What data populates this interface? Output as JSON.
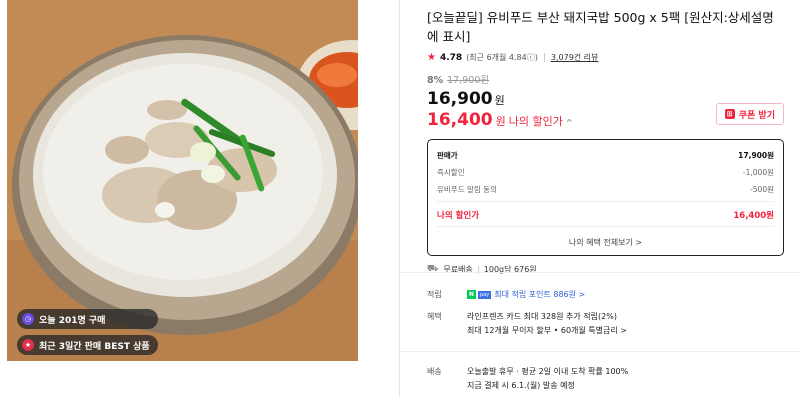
{
  "product": {
    "title": "[오늘끝딜] 유비푸드 부산 돼지국밥 500g x 5팩 [원산지:상세설명에 표시]",
    "image_alt": "돼지국밥",
    "badges": [
      {
        "icon": "clock-icon",
        "text": "오늘 201명 구매"
      },
      {
        "icon": "trophy-icon",
        "text": "최근 3일간 판매 BEST 상품"
      }
    ]
  },
  "rating": {
    "score": "4.78",
    "recent": "(최근 6개월 4.84",
    "info_icon": "ⓘ",
    "recent_close": ")",
    "reviews": "3,079건 리뷰"
  },
  "pricing": {
    "discount_rate": "8%",
    "original_price": "17,900원",
    "sale_price": "16,900",
    "sale_unit": "원",
    "my_price": "16,400",
    "my_unit": "원",
    "my_label": "나의 할인가",
    "my_toggle": "^",
    "coupon_button": "쿠폰 받기"
  },
  "price_box": {
    "rows": [
      {
        "label": "판매가",
        "value": "17,900원"
      },
      {
        "label": "즉시할인",
        "value": "-1,000원"
      },
      {
        "label": "유비푸드 알림 동의",
        "value": "-500원"
      }
    ],
    "total_label": "나의 할인가",
    "total_value": "16,400원",
    "more_link": "나의 혜택 전체보기 >"
  },
  "shipping_summary": {
    "free": "무료배송",
    "unit_price": "100g당 676원"
  },
  "info": {
    "points_label": "적립",
    "points_text": "최대 적립 포인트 886원 >",
    "benefit_label": "혜택",
    "benefit_line1": "라인프렌즈 카드 최대 328원 추가 적립(2%)",
    "benefit_line2": "최대 12개월 무이자 할부 • 60개월 특별금리 >",
    "delivery_label": "배송",
    "delivery_line1": "오늘출발 휴무 · 평균 2일 이내 도착 확률 100%",
    "delivery_line2": "지금 결제 시 6.1.(월) 발송 예정"
  },
  "colors": {
    "accent_red": "#f0243c",
    "link_blue": "#2d5fd8",
    "naver_green": "#03c75a"
  }
}
